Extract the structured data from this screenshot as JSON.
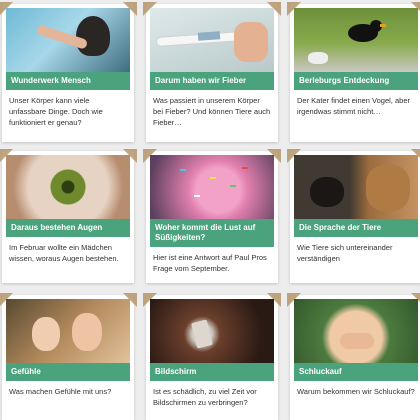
{
  "cards": [
    {
      "title": "Wunderwerk Mensch",
      "text": "Unser Körper kann viele unfassbare Dinge. Doch wie funktioniert er genau?",
      "image": "child-touching-water-photo"
    },
    {
      "title": "Darum haben wir Fieber",
      "text": "Was passiert in unserem Körper bei Fieber? Und können Tiere auch Fieber…",
      "image": "thermometer-photo"
    },
    {
      "title": "Berleburgs Entdeckung",
      "text": "Der Kater findet einen Vogel, aber irgendwas stimmt nicht…",
      "image": "blackbird-photo"
    },
    {
      "title": "Daraus bestehen Augen",
      "text": "Im Februar wollte ein Mädchen wissen, woraus Augen bestehen.",
      "image": "eye-closeup-photo"
    },
    {
      "title": "Woher kommt die Lust auf Süßigkeiten?",
      "text": "Hier ist eine Antwort auf Paul Pros Frage vom September.",
      "image": "sprinkle-donut-photo"
    },
    {
      "title": "Die Sprache der Tiere",
      "text": "Wie Tiere sich untereinander verständigen",
      "image": "cat-and-dog-photo"
    },
    {
      "title": "Gefühle",
      "text": "Was machen Gefühle mit uns?",
      "image": "two-children-photo"
    },
    {
      "title": "Bildschirm",
      "text": "Ist es schädlich, zu viel Zeit vor Bildschirmen zu verbringen?",
      "image": "child-with-phone-photo"
    },
    {
      "title": "Schluckauf",
      "text": "Warum bekommen wir Schluckauf?",
      "image": "child-covering-mouth-photo"
    }
  ],
  "colors": {
    "accent": "#4aa37d",
    "background": "#ededed",
    "card": "#ffffff",
    "tape": "#b89a72"
  }
}
